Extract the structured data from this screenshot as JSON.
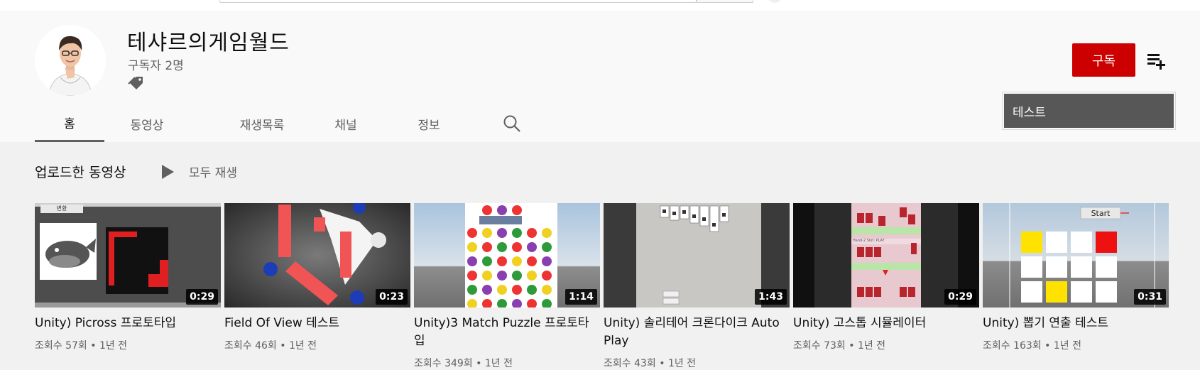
{
  "channel": {
    "name": "테샤르의게임월드",
    "subscribers": "구독자 2명"
  },
  "actions": {
    "subscribe_label": "구독",
    "tooltip_text": "테스트"
  },
  "tabs": [
    "홈",
    "동영상",
    "재생목록",
    "채널",
    "정보"
  ],
  "section": {
    "title": "업로드한 동영상",
    "play_all": "모두 재생"
  },
  "videos": [
    {
      "title": "Unity) Picross 프로토타입",
      "meta": "조회수 57회 • 1년 전",
      "duration": "0:29"
    },
    {
      "title": "Field Of View 테스트",
      "meta": "조회수 46회 • 1년 전",
      "duration": "0:23"
    },
    {
      "title": "Unity)3 Match Puzzle 프로토타입",
      "meta": "조회수 349회 • 1년 전",
      "duration": "1:14"
    },
    {
      "title": "Unity) 솔리테어 크론다이크 Auto Play",
      "meta": "조회수 43회 • 1년 전",
      "duration": "1:43"
    },
    {
      "title": "Unity) 고스톱 시뮬레이터",
      "meta": "조회수 73회 • 1년 전",
      "duration": "0:29"
    },
    {
      "title": "Unity) 뽑기 연출 테스트",
      "meta": "조회수 163회 • 1년 전",
      "duration": "0:31"
    }
  ],
  "thumb_texts": {
    "picross_button": "변환",
    "gostop_caption": "Hand-2 Slot: PLAY",
    "gacha_start": "Start"
  },
  "colors": {
    "subscribe": "#cc0000",
    "tooltip_bg": "#575757",
    "page_bg": "#f1f1f1",
    "header_bg": "#f9f9f9"
  },
  "icons": [
    "channel-avatar",
    "tag-icon",
    "playlist-add-icon",
    "search-icon",
    "play-icon"
  ]
}
